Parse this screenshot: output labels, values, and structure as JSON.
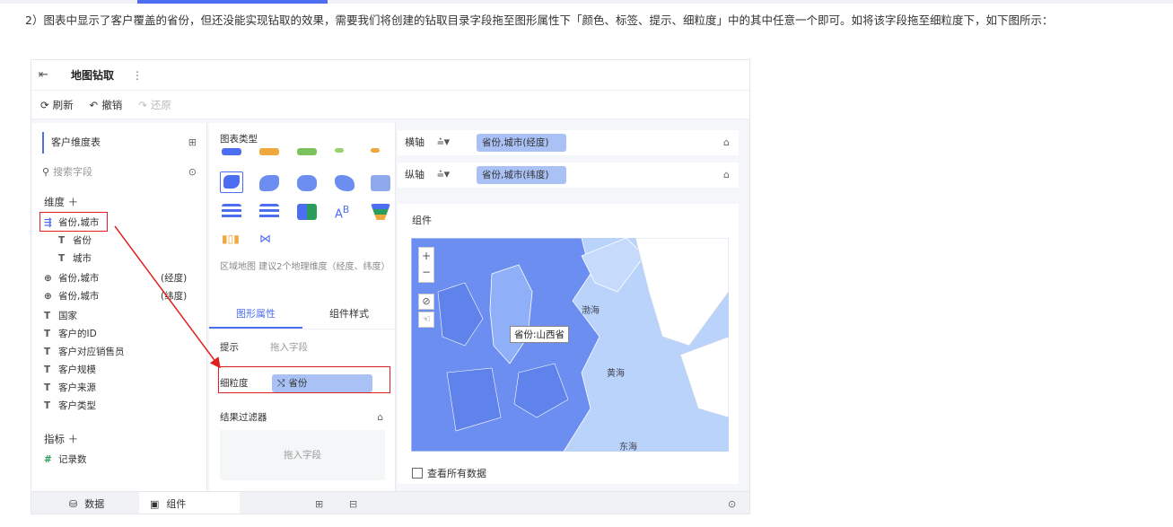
{
  "intro_text": "2）图表中显示了客户覆盖的省份，但还没能实现钻取的效果，需要我们将创建的钻取目录字段拖至图形属性下「颜色、标签、提示、细粒度」中的其中任意一个即可。如将该字段拖至细粒度下，如下图所示：",
  "window": {
    "title": "地图钻取",
    "more": "⋮"
  },
  "toolbar": {
    "refresh": "刷新",
    "undo": "撤销",
    "redo": "还原"
  },
  "left": {
    "dataset": "客户维度表",
    "search_placeholder": "搜索字段",
    "dimension_title": "维度 ＋",
    "fields": [
      {
        "icon": "drill-icon",
        "name": "省份,城市",
        "tag": ""
      },
      {
        "icon": "T",
        "name": "省份",
        "tag": ""
      },
      {
        "icon": "T",
        "name": "城市",
        "tag": ""
      },
      {
        "icon": "globe-icon",
        "name": "省份,城市",
        "tag": "(经度)"
      },
      {
        "icon": "globe-icon",
        "name": "省份,城市",
        "tag": "(纬度)"
      },
      {
        "icon": "T",
        "name": "国家",
        "tag": ""
      },
      {
        "icon": "T",
        "name": "客户的ID",
        "tag": ""
      },
      {
        "icon": "T",
        "name": "客户对应销售员",
        "tag": ""
      },
      {
        "icon": "T",
        "name": "客户规模",
        "tag": ""
      },
      {
        "icon": "T",
        "name": "客户来源",
        "tag": ""
      },
      {
        "icon": "T",
        "name": "客户类型",
        "tag": ""
      }
    ],
    "metric_title": "指标 ＋",
    "metric": "记录数"
  },
  "middle": {
    "chart_type_label": "图表类型",
    "hint": "区域地图 建议2个地理维度（经度、纬度）",
    "tab_graphic": "图形属性",
    "tab_style": "组件样式",
    "tooltip_label": "提示",
    "drop_placeholder": "拖入字段",
    "granularity_label": "细粒度",
    "granularity_value": "省份",
    "filter_label": "结果过滤器",
    "filter_drop": "拖入字段"
  },
  "right": {
    "x_axis_label": "横轴",
    "x_axis_value": "省份,城市(经度)",
    "y_axis_label": "纵轴",
    "y_axis_value": "省份,城市(纬度)",
    "component_label": "组件",
    "tooltip": "省份:山西省",
    "sea_bohai": "渤海",
    "sea_yellow": "黄海",
    "sea_east": "东海",
    "show_all": "查看所有数据"
  },
  "bottom": {
    "data_tab": "数据",
    "component_tab": "组件"
  },
  "colors": {
    "accent": "#4e6ef2",
    "highlight_red": "#e02020",
    "map_land": "#6b8ef0",
    "map_sea": "#b9d3fb"
  }
}
